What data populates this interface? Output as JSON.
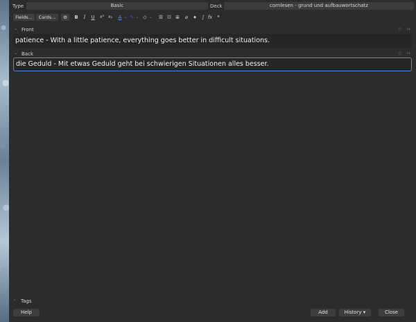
{
  "header": {
    "type_label": "Type",
    "type_value": "Basic",
    "deck_label": "Deck",
    "deck_value": "cornlesen - grund und aufbauwortschatz"
  },
  "toolbar": {
    "fields_label": "Fields...",
    "cards_label": "Cards...",
    "bold_glyph": "B",
    "italic_glyph": "I",
    "underline_glyph": "U",
    "superscript_glyph": "x²",
    "subscript_glyph": "x₂",
    "text_color_glyph": "A",
    "highlight_glyph": "✎",
    "eraser_glyph": "◇",
    "unordered_list_glyph": "☰",
    "ordered_list_glyph": "☷",
    "indent_glyph": "≣",
    "attach_glyph": "⌀",
    "record_glyph": "⏺",
    "mathjax_glyph": "∫",
    "html_glyph": "fx",
    "more_glyph": "⯆",
    "text_color": "#6b8cff",
    "highlight_color": "#3a5bd6"
  },
  "fields": [
    {
      "name": "Front",
      "content": "patience - With a little patience, everything goes better in difficult situations."
    },
    {
      "name": "Back",
      "content": "die Geduld - Mit etwas Geduld geht bei schwierigen Situationen alles besser."
    }
  ],
  "tags": {
    "label": "Tags"
  },
  "buttons": {
    "help": "Help",
    "add": "Add",
    "history": "History ▾",
    "close": "Close"
  },
  "icons": {
    "collapse": "⌄",
    "expand": "›",
    "pin": "☆",
    "html_toggle": "‹›"
  },
  "colors": {
    "focus_border": "#4d8fd6",
    "background": "#2c2c2c",
    "editor_bg": "#262626"
  }
}
